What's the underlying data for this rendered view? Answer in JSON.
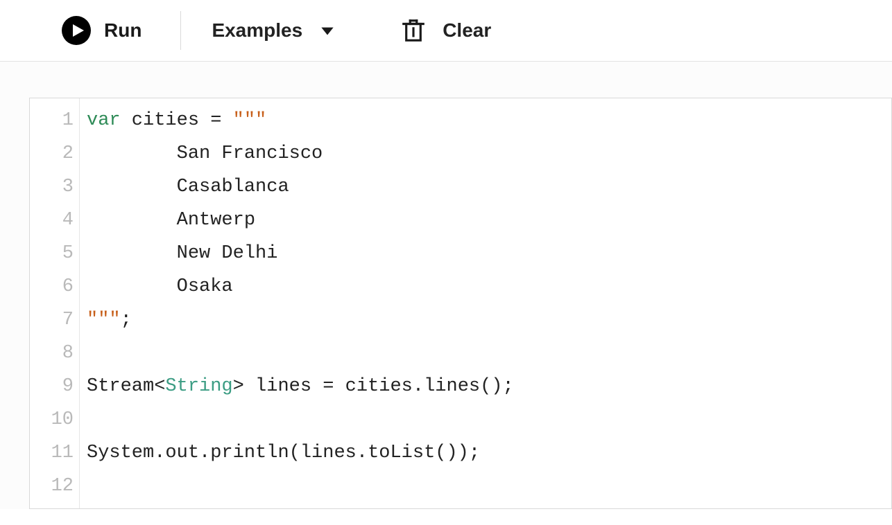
{
  "toolbar": {
    "run_label": "Run",
    "examples_label": "Examples",
    "clear_label": "Clear"
  },
  "editor": {
    "lines": [
      [
        {
          "cls": "tok-kw",
          "text": "var"
        },
        {
          "cls": "tok-plain",
          "text": " cities = "
        },
        {
          "cls": "tok-str",
          "text": "\"\"\""
        }
      ],
      [
        {
          "cls": "tok-plain",
          "text": "        San Francisco"
        }
      ],
      [
        {
          "cls": "tok-plain",
          "text": "        Casablanca"
        }
      ],
      [
        {
          "cls": "tok-plain",
          "text": "        Antwerp"
        }
      ],
      [
        {
          "cls": "tok-plain",
          "text": "        New Delhi"
        }
      ],
      [
        {
          "cls": "tok-plain",
          "text": "        Osaka"
        }
      ],
      [
        {
          "cls": "tok-str",
          "text": "\"\"\""
        },
        {
          "cls": "tok-plain",
          "text": ";"
        }
      ],
      [
        {
          "cls": "tok-plain",
          "text": ""
        }
      ],
      [
        {
          "cls": "tok-plain",
          "text": "Stream<"
        },
        {
          "cls": "tok-type",
          "text": "String"
        },
        {
          "cls": "tok-plain",
          "text": "> lines = cities.lines();"
        }
      ],
      [
        {
          "cls": "tok-plain",
          "text": ""
        }
      ],
      [
        {
          "cls": "tok-plain",
          "text": "System.out.println(lines.toList());"
        }
      ],
      [
        {
          "cls": "tok-plain",
          "text": ""
        }
      ]
    ]
  }
}
